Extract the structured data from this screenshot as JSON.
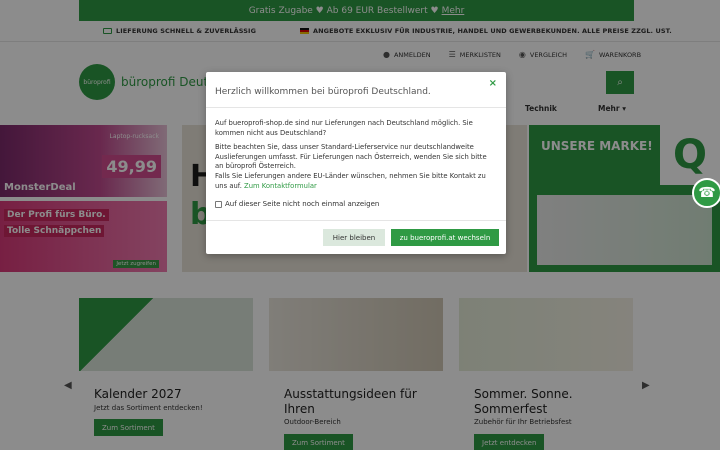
{
  "topbar": {
    "text": "Gratis Zugabe ♥ Ab 69 EUR Bestellwert ♥",
    "link": "Mehr"
  },
  "infobar": {
    "delivery": "LIEFERUNG SCHNELL & ZUVERLÄSSIG",
    "offer": "ANGEBOTE EXKLUSIV FÜR INDUSTRIE, HANDEL UND GEWERBEKUNDEN. ALLE PREISE ZZGL. UST."
  },
  "account": {
    "login": "ANMELDEN",
    "list": "MERKLISTEN",
    "compare": "VERGLEICH",
    "cart": "WARENKORB"
  },
  "header": {
    "logo_text": "büroprofi",
    "brand": "büroprofi Deutschland",
    "search_icon": "⌕"
  },
  "nav": {
    "tech": "Technik",
    "more": "Mehr ▾"
  },
  "banners": {
    "left1_label": "Laptop-rucksack",
    "left1_price": "49,99",
    "left1_title": "MonsterDeal",
    "left2_line1": "Der Profi fürs Büro.",
    "left2_line2": "Tolle Schnäppchen",
    "left2_btn": "Jetzt zugreifen",
    "mid_big": "H",
    "mid_small": "b",
    "right_title": "UNSERE MARKE!",
    "right_q": "Q"
  },
  "cards": [
    {
      "title": "Kalender 2027",
      "sub": "Jetzt das Sortiment entdecken!",
      "btn": "Zum Sortiment",
      "img_color": "#cfd8cf"
    },
    {
      "title": "Ausstattungsideen für Ihren",
      "sub": "Outdoor-Bereich",
      "btn": "Zum Sortiment",
      "img_color": "#e8e4dc"
    },
    {
      "title": "Sommer. Sonne. Sommerfest",
      "sub": "Zubehör für Ihr Betriebsfest",
      "btn": "Jetzt entdecken",
      "img_color": "#e3ead5"
    }
  ],
  "modal": {
    "title": "Herzlich willkommen bei büroprofi Deutschland.",
    "p1": "Auf bueroprofi-shop.de sind nur Lieferungen nach Deutschland möglich. Sie kommen nicht aus Deutschland?",
    "p2a": "Bitte beachten Sie, dass unser Standard-Lieferservice nur deutschlandweite Auslieferungen umfasst. Für Lieferungen nach Österreich, wenden Sie sich bitte an büroprofi Österreich.",
    "p2b": "Falls Sie Lieferungen andere EU-Länder wünschen, nehmen Sie bitte Kontakt zu uns auf.",
    "p2link": "Zum Kontaktformular",
    "checkbox": "Auf dieser Seite nicht noch einmal anzeigen",
    "stay": "Hier bleiben",
    "go": "zu bueroprofi.at wechseln",
    "close": "×"
  }
}
